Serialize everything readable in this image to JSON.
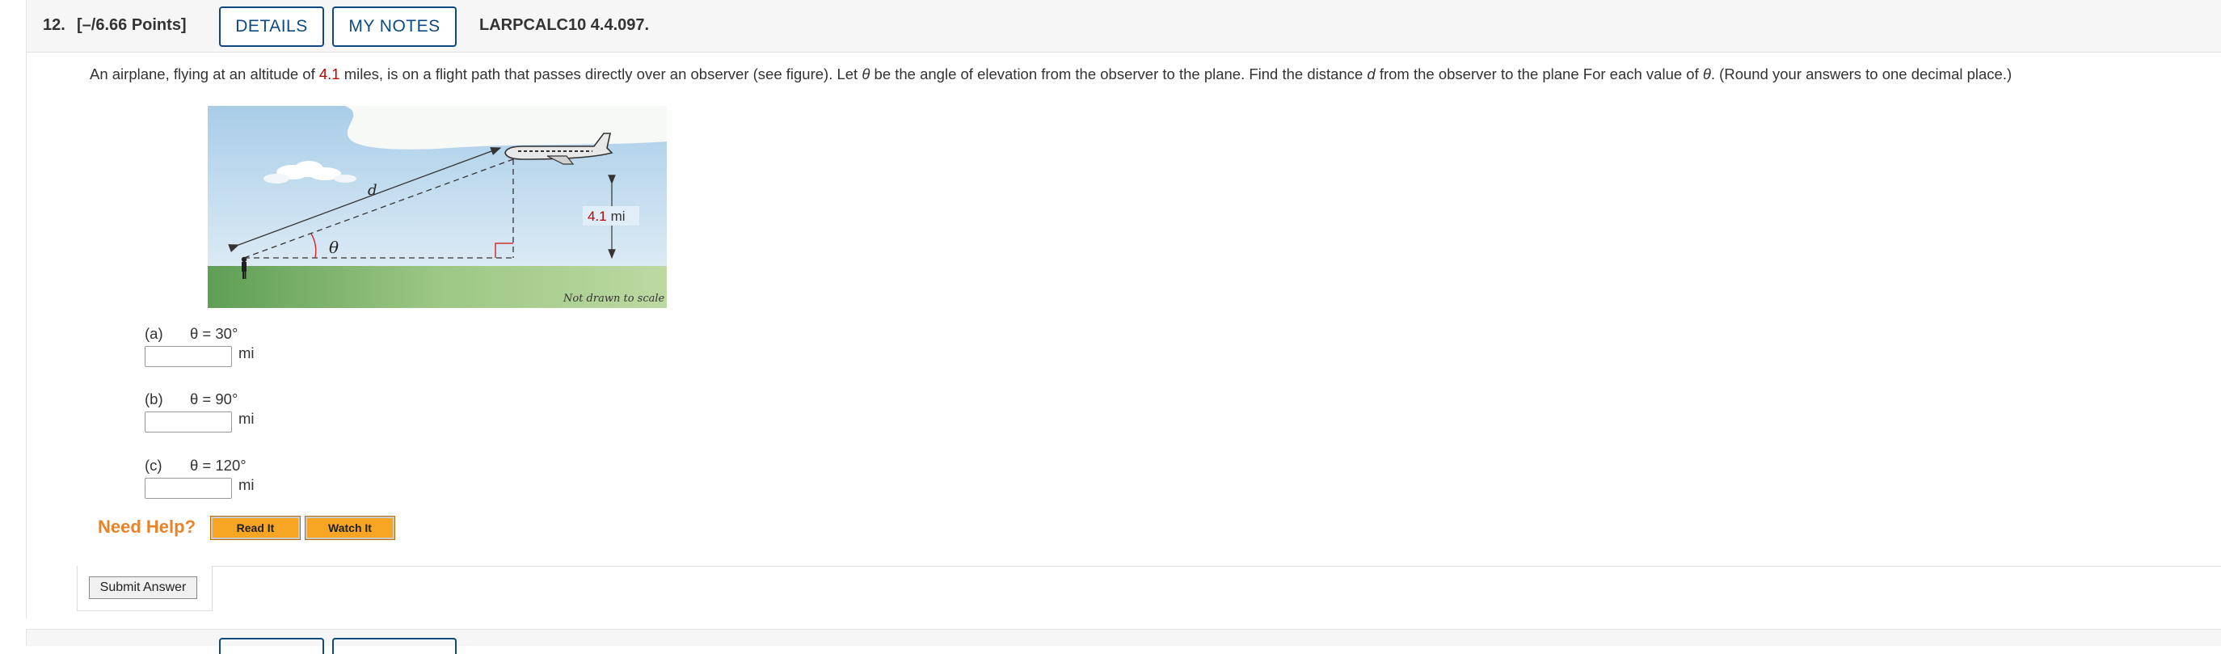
{
  "question": {
    "number": "12.",
    "points": "[–/6.66 Points]",
    "details_label": "DETAILS",
    "notes_label": "MY NOTES",
    "code": "LARPCALC10 4.4.097."
  },
  "prompt": {
    "p1": "An airplane, flying at an altitude of ",
    "altitude": "4.1",
    "p2": " miles, is on a flight path that passes directly over an observer (see figure). Let ",
    "theta1": "θ",
    "p3": " be the angle of elevation from the observer to the plane. Find the distance ",
    "d": "d",
    "p4": " from the observer to the plane For each value of ",
    "theta2": "θ",
    "p5": ". (Round your answers to one decimal place.)"
  },
  "figure": {
    "d_label": "d",
    "theta_label": "θ",
    "altitude_value": "4.1",
    "altitude_unit": "mi",
    "note": "Not drawn to scale"
  },
  "parts": [
    {
      "label": "(a)",
      "equation": "θ = 30°",
      "value": "",
      "unit": "mi"
    },
    {
      "label": "(b)",
      "equation": "θ = 90°",
      "value": "",
      "unit": "mi"
    },
    {
      "label": "(c)",
      "equation": "θ = 120°",
      "value": "",
      "unit": "mi"
    }
  ],
  "help": {
    "title": "Need Help?",
    "read_label": "Read It",
    "watch_label": "Watch It"
  },
  "submit_label": "Submit Answer",
  "colors": {
    "link_blue": "#0e4a80",
    "value_red": "#c00000",
    "help_orange": "#e8832a",
    "help_button": "#f6a623",
    "sky": "#bcd9ee",
    "ground": "#7fb56a"
  }
}
